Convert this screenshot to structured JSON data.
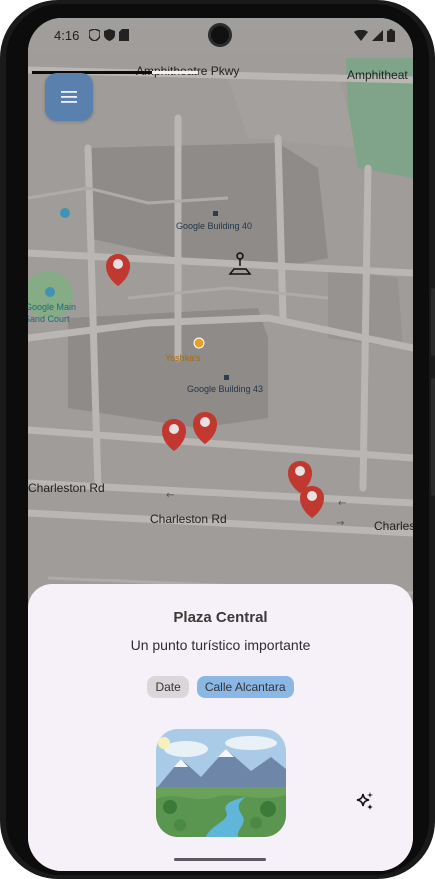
{
  "status_bar": {
    "time": "4:16",
    "left_icons": [
      "shield-icon",
      "privacy-icon",
      "sd-card-icon"
    ],
    "right_icons": [
      "wifi-icon",
      "signal-icon",
      "battery-icon"
    ]
  },
  "map": {
    "labels": {
      "amphitheatre_pkwy": "Amphitheatre Pkwy",
      "amphitheatre_right": "Amphitheat",
      "google_building_40": "Google Building 40",
      "google_main_sand_court_1": "Google Main",
      "google_main_sand_court_2": "Sand Court",
      "yoshkas": "Yoshka's",
      "google_building_43": "Google Building 43",
      "charleston_rd_1": "Charleston Rd",
      "charleston_rd_2": "Charleston Rd",
      "charleston_rd_3": "Charleston Rd"
    },
    "marker_count": 5,
    "colors": {
      "marker": "#c0382f",
      "water": "#8fc3e8",
      "park": "#7bb88a"
    }
  },
  "menu_button": {
    "icon": "menu-icon"
  },
  "loading_progress": 0.72,
  "sheet": {
    "title": "Plaza Central",
    "subtitle": "Un punto turístico importante",
    "chips": [
      "Date",
      "Calle Alcantara"
    ],
    "image": "landscape-thumbnail",
    "action_icon": "sparkle-icon"
  }
}
